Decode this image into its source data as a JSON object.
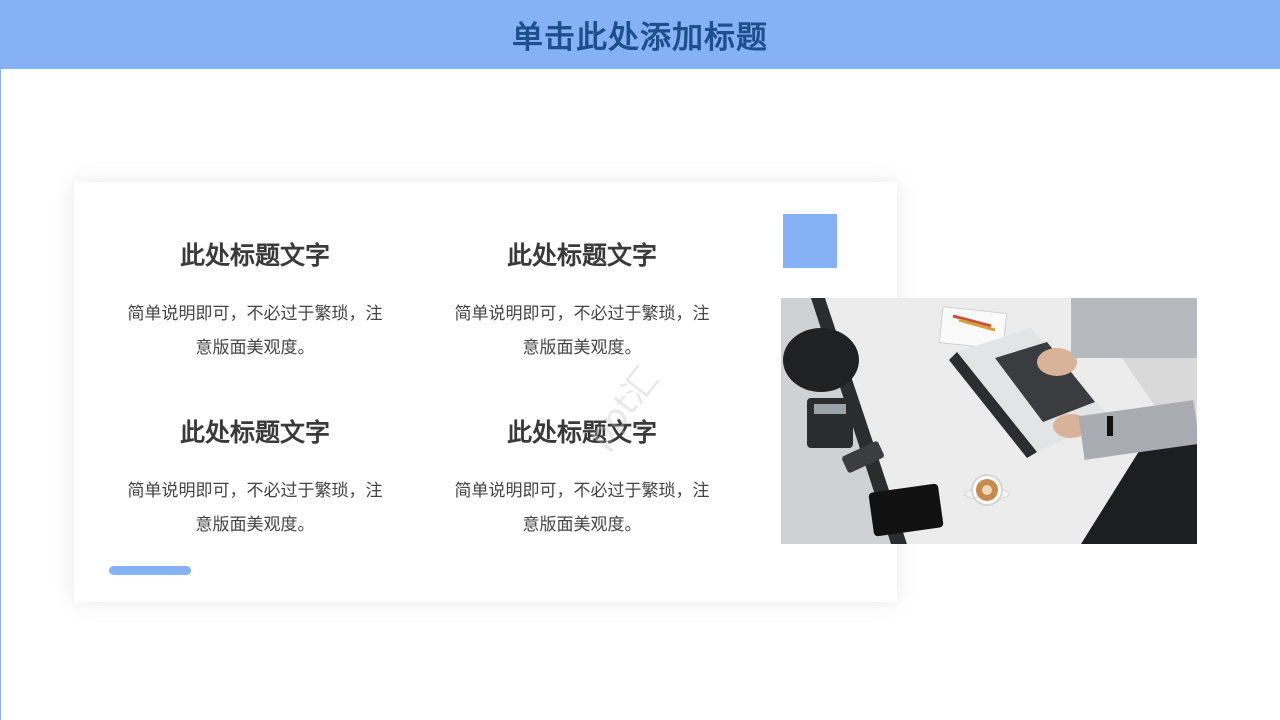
{
  "colors": {
    "accent": "#86b2f5",
    "title_text": "#1e4f8c",
    "body_text": "#3a3a3a"
  },
  "header": {
    "title": "单击此处添加标题"
  },
  "card": {
    "items": [
      {
        "title": "此处标题文字",
        "desc_line1": "简单说明即可，不必过于繁琐，注",
        "desc_line2": "意版面美观度。"
      },
      {
        "title": "此处标题文字",
        "desc_line1": "简单说明即可，不必过于繁琐，注",
        "desc_line2": "意版面美观度。"
      },
      {
        "title": "此处标题文字",
        "desc_line1": "简单说明即可，不必过于繁琐，注",
        "desc_line2": "意版面美观度。"
      },
      {
        "title": "此处标题文字",
        "desc_line1": "简单说明即可，不必过于繁琐，注",
        "desc_line2": "意版面美观度。"
      }
    ]
  },
  "watermark": "ppt汇"
}
